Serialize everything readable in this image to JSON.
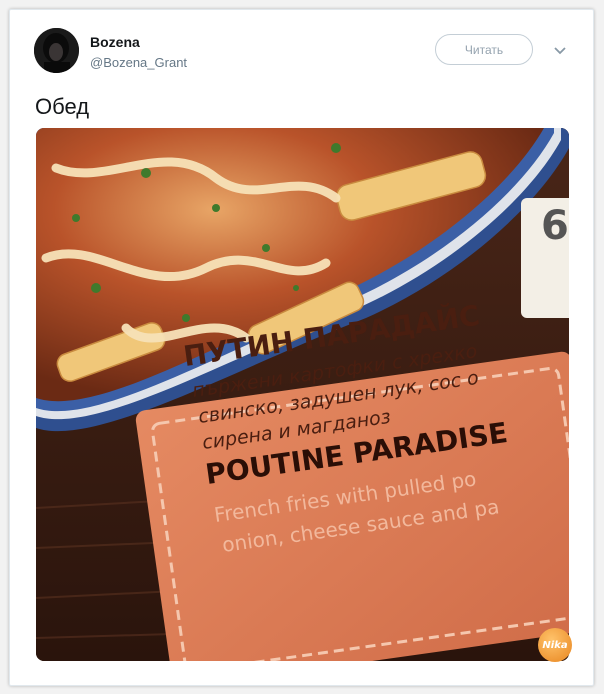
{
  "user": {
    "name": "Bozena",
    "handle": "@Bozena_Grant"
  },
  "actions": {
    "follow_label": "Читать"
  },
  "tweet": {
    "text": "Обед"
  },
  "photo_label": {
    "title_bg": "ПУТИН ПАРАДАЙС",
    "desc_bg_1": "пържени картофки с хрехко",
    "desc_bg_2": "свинско, задушен лук, сос о",
    "desc_bg_3": "сирена и магданоз",
    "title_en": "POUTINE PARADISE",
    "desc_en_1": "French fries with pulled po",
    "desc_en_2": "onion, cheese sauce and pa",
    "price_fragment": "6"
  },
  "icons": {
    "chevron": "chevron-down-icon"
  }
}
